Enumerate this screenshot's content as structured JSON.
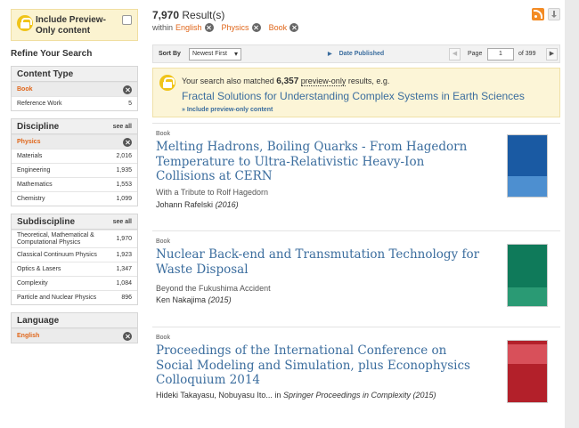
{
  "sidebar": {
    "preview_label": "Include Preview-Only content",
    "refine_title": "Refine Your Search",
    "content_type": {
      "title": "Content Type",
      "selected": "Book",
      "items": [
        {
          "label": "Reference Work",
          "count": "5"
        }
      ]
    },
    "discipline": {
      "title": "Discipline",
      "see_all": "see all",
      "selected": "Physics",
      "items": [
        {
          "label": "Materials",
          "count": "2,016"
        },
        {
          "label": "Engineering",
          "count": "1,935"
        },
        {
          "label": "Mathematics",
          "count": "1,553"
        },
        {
          "label": "Chemistry",
          "count": "1,099"
        }
      ]
    },
    "subdiscipline": {
      "title": "Subdiscipline",
      "see_all": "see all",
      "items": [
        {
          "label": "Theoretical, Mathematical & Computational Physics",
          "count": "1,970"
        },
        {
          "label": "Classical Continuum Physics",
          "count": "1,923"
        },
        {
          "label": "Optics & Lasers",
          "count": "1,347"
        },
        {
          "label": "Complexity",
          "count": "1,084"
        },
        {
          "label": "Particle and Nuclear Physics",
          "count": "896"
        }
      ]
    },
    "language": {
      "title": "Language",
      "selected": "English"
    }
  },
  "results_header": {
    "count": "7,970",
    "count_suffix": "Result(s)",
    "within_label": "within",
    "filters": [
      "English",
      "Physics",
      "Book"
    ]
  },
  "sortbar": {
    "sort_by_label": "Sort By",
    "sort_value": "Newest First",
    "date_published": "Date Published",
    "page_label": "Page",
    "page_value": "1",
    "of_pages": "of 399"
  },
  "preview_notice": {
    "prefix": "Your search also matched",
    "count": "6,357",
    "mid": "preview-only",
    "suffix": "results, e.g.",
    "example": "Fractal Solutions for Understanding Complex Systems in Earth Sciences",
    "include_link": "» Include preview-only content"
  },
  "results": [
    {
      "type": "Book",
      "title": "Melting Hadrons, Boiling Quarks - From Hagedorn Temperature to Ultra-Relativistic Heavy-Ion Collisions at CERN",
      "subtitle": "With a Tribute to Rolf Hagedorn",
      "authors": "Johann Rafelski",
      "year": "(2016)",
      "cover_color": "#1a5aa3"
    },
    {
      "type": "Book",
      "title": "Nuclear Back-end and Transmutation Technology for Waste Disposal",
      "subtitle": "Beyond the Fukushima Accident",
      "authors": "Ken Nakajima",
      "year": "(2015)",
      "cover_color": "#0f7a5a"
    },
    {
      "type": "Book",
      "title": "Proceedings of the International Conference on Social Modeling and Simulation, plus Econophysics Colloquium 2014",
      "subtitle": "",
      "authors": "Hideki Takayasu, Nobuyasu Ito...",
      "in_label": "in",
      "series": "Springer Proceedings in Complexity (2015)",
      "cover_color": "#b3202a"
    }
  ]
}
